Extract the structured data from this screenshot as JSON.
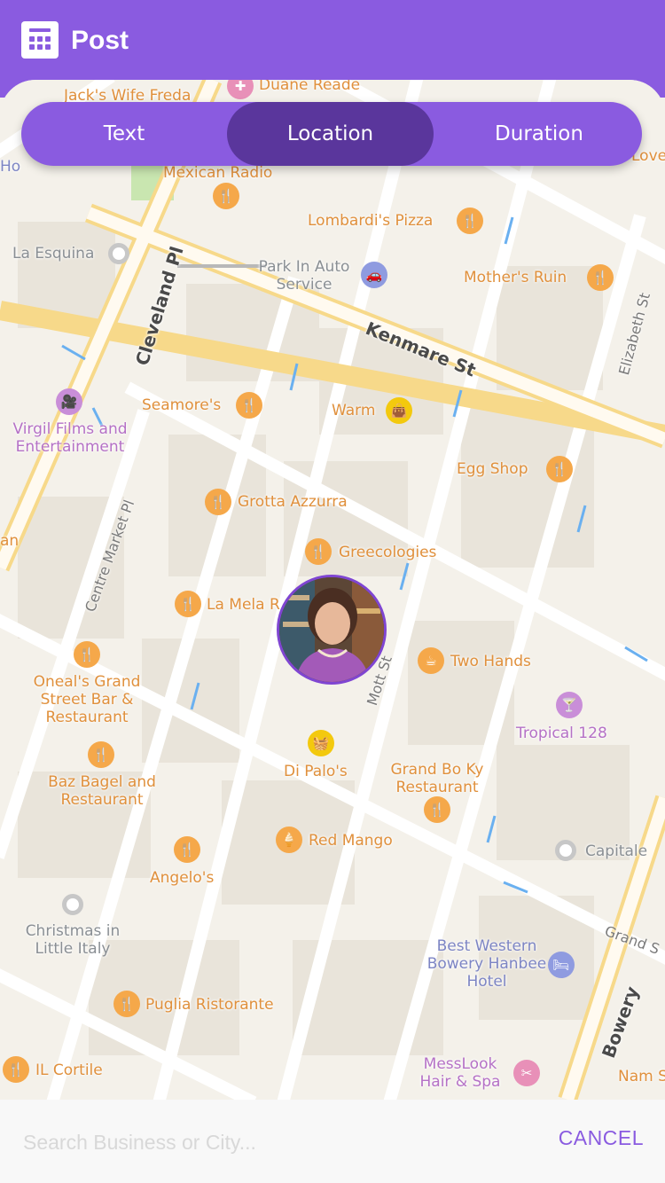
{
  "header": {
    "title": "Post",
    "icon": "calculator-icon",
    "color": "#8a5be0"
  },
  "tabs": [
    {
      "label": "Text",
      "active": false
    },
    {
      "label": "Location",
      "active": true
    },
    {
      "label": "Duration",
      "active": false
    }
  ],
  "map": {
    "streets": [
      "Kenmare St",
      "Cleveland Pl",
      "Centre Market Pl",
      "Elizabeth St",
      "Mott St",
      "Bowery",
      "Grand S"
    ],
    "places": [
      {
        "name": "Jack's Wife Freda",
        "icon": "restaurant-icon"
      },
      {
        "name": "Duane Reade",
        "icon": "pharmacy-icon"
      },
      {
        "name": "Ho",
        "icon": ""
      },
      {
        "name": "Love",
        "icon": ""
      },
      {
        "name": "Mexican Radio",
        "icon": "restaurant-icon"
      },
      {
        "name": "Lombardi's Pizza",
        "icon": "restaurant-icon"
      },
      {
        "name": "La Esquina",
        "icon": "place-icon"
      },
      {
        "name": "Park In Auto Service",
        "icon": "car-icon"
      },
      {
        "name": "Mother's Ruin",
        "icon": "restaurant-icon"
      },
      {
        "name": "Virgil Films and Entertainment",
        "icon": "film-camera-icon"
      },
      {
        "name": "Seamore's",
        "icon": "restaurant-icon"
      },
      {
        "name": "Warm",
        "icon": "shopping-bag-icon"
      },
      {
        "name": "Egg Shop",
        "icon": "restaurant-icon"
      },
      {
        "name": "Grotta Azzurra",
        "icon": "restaurant-icon"
      },
      {
        "name": "an",
        "icon": ""
      },
      {
        "name": "Greecologies",
        "icon": "restaurant-icon"
      },
      {
        "name": "La Mela R",
        "icon": "restaurant-icon"
      },
      {
        "name": "Two Hands",
        "icon": "coffee-icon"
      },
      {
        "name": "Oneal's Grand Street Bar & Restaurant",
        "icon": "restaurant-icon"
      },
      {
        "name": "Tropical 128",
        "icon": "cocktail-icon"
      },
      {
        "name": "Di Palo's",
        "icon": "basket-icon"
      },
      {
        "name": "Grand Bo Ky Restaurant",
        "icon": "restaurant-icon"
      },
      {
        "name": "Baz Bagel and Restaurant",
        "icon": "restaurant-icon"
      },
      {
        "name": "Red Mango",
        "icon": "ice-cream-icon"
      },
      {
        "name": "Capitale",
        "icon": "place-icon"
      },
      {
        "name": "Angelo's",
        "icon": "restaurant-icon"
      },
      {
        "name": "Christmas in Little Italy",
        "icon": "place-icon"
      },
      {
        "name": "Best Western Bowery Hanbee Hotel",
        "icon": "bed-icon"
      },
      {
        "name": "Puglia Ristorante",
        "icon": "restaurant-icon"
      },
      {
        "name": "IL Cortile",
        "icon": "restaurant-icon"
      },
      {
        "name": "MessLook Hair & Spa",
        "icon": "salon-icon"
      },
      {
        "name": "Nam S",
        "icon": ""
      }
    ],
    "user_avatar": "user-avatar"
  },
  "search": {
    "placeholder": "Search Business or City...",
    "value": ""
  },
  "cancel_label": "CANCEL"
}
